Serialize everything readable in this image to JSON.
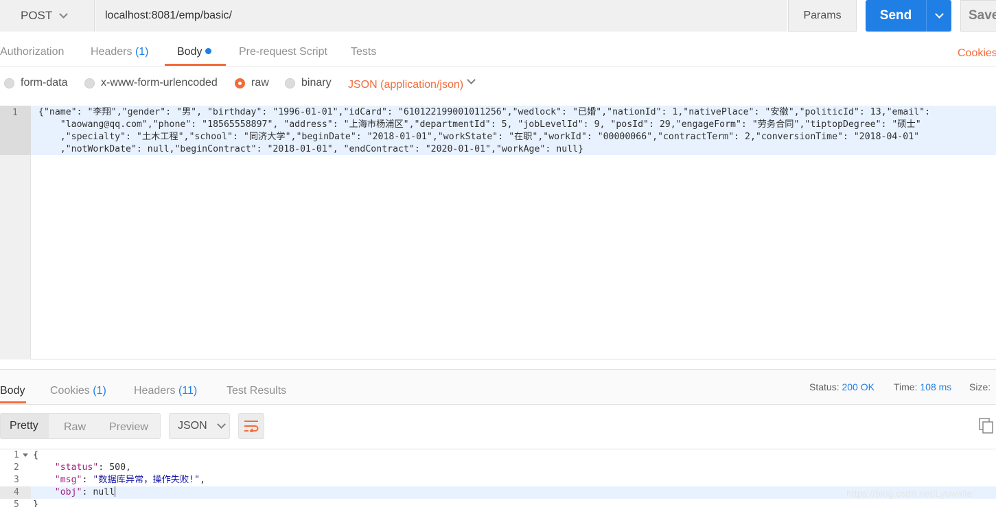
{
  "request": {
    "method": "POST",
    "url": "localhost:8081/emp/basic/",
    "params_label": "Params",
    "send_label": "Send",
    "save_label": "Save",
    "tabs": [
      {
        "label": "Authorization"
      },
      {
        "label": "Headers",
        "count": "(1)"
      },
      {
        "label": "Body",
        "active": true
      },
      {
        "label": "Pre-request Script"
      },
      {
        "label": "Tests"
      }
    ],
    "cookies_label": "Cookies",
    "body_types": [
      "form-data",
      "x-www-form-urlencoded",
      "raw",
      "binary"
    ],
    "selected_body_type": "raw",
    "content_type": "JSON (application/json)",
    "editor": {
      "line_number": "1",
      "lines": [
        "{\"name\": \"李翔\",\"gender\": \"男\", \"birthday\": \"1996-01-01\",\"idCard\": \"610122199001011256\",\"wedlock\": \"已婚\",\"nationId\": 1,\"nativePlace\": \"安徽\",\"politicId\": 13,\"email\":",
        "    \"laowang@qq.com\",\"phone\": \"18565558897\", \"address\": \"上海市杨浦区\",\"departmentId\": 5, \"jobLevelId\": 9, \"posId\": 29,\"engageForm\": \"劳务合同\",\"tiptopDegree\": \"硕士\"",
        "    ,\"specialty\": \"土木工程\",\"school\": \"同济大学\",\"beginDate\": \"2018-01-01\",\"workState\": \"在职\",\"workId\": \"00000066\",\"contractTerm\": 2,\"conversionTime\": \"2018-04-01\"",
        "    ,\"notWorkDate\": null,\"beginContract\": \"2018-01-01\", \"endContract\": \"2020-01-01\",\"workAge\": null}"
      ]
    }
  },
  "response": {
    "tabs": [
      {
        "label": "Body",
        "active": true
      },
      {
        "label": "Cookies",
        "count": "(1)"
      },
      {
        "label": "Headers",
        "count": "(11)"
      },
      {
        "label": "Test Results"
      }
    ],
    "status_label": "Status:",
    "status_value": "200 OK",
    "time_label": "Time:",
    "time_value": "108 ms",
    "size_label": "Size:",
    "view_modes": [
      "Pretty",
      "Raw",
      "Preview"
    ],
    "active_view": "Pretty",
    "format": "JSON",
    "line_numbers": [
      "1",
      "2",
      "3",
      "4",
      "5"
    ],
    "code": {
      "open": "{",
      "status_key": "\"status\"",
      "status_val": "500",
      "msg_key": "\"msg\"",
      "msg_val": "\"数据库异常，操作失败!\"",
      "obj_key": "\"obj\"",
      "obj_val": "null",
      "close": "}"
    },
    "watermark": "https://blog.csdn.net/Lyuwalle"
  },
  "colors": {
    "accent_orange": "#f26b3a",
    "send_blue": "#1f7fe5"
  }
}
